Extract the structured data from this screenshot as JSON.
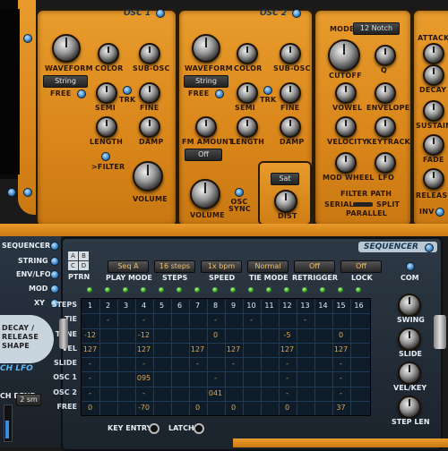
{
  "osc1": {
    "title": "OSC 1",
    "waveform_label": "WAVEFORM",
    "waveform_value": "String",
    "color_label": "COLOR",
    "subosc_label": "SUB-OSC",
    "free_label": "FREE",
    "semi_label": "SEMI",
    "trk_label": "TRK",
    "fine_label": "FINE",
    "length_label": "LENGTH",
    "damp_label": "DAMP",
    "filter_label": ">FILTER",
    "volume_label": "VOLUME"
  },
  "osc2": {
    "title": "OSC 2",
    "waveform_label": "WAVEFORM",
    "waveform_value": "String",
    "color_label": "COLOR",
    "subosc_label": "SUB-OSC",
    "free_label": "FREE",
    "semi_label": "SEMI",
    "trk_label": "TRK",
    "fine_label": "FINE",
    "fm_amount_label": "FM AMOUNT",
    "fm_value": "Off",
    "length_label": "LENGTH",
    "damp_label": "DAMP",
    "volume_label": "VOLUME",
    "osc_sync_label": "OSC SYNC",
    "sat_value": "Sat",
    "dist_label": "DIST"
  },
  "filter": {
    "mode_label": "MODE",
    "mode_value": "12 Notch",
    "cutoff_label": "CUTOFF",
    "q_label": "Q",
    "vowel_label": "VOWEL",
    "envelope_label": "ENVELOPE",
    "velocity_label": "VELOCITY",
    "keytrack_label": "KEYTRACK",
    "modwheel_label": "MOD WHEEL",
    "lfo_label": "LFO",
    "path_label": "FILTER PATH",
    "serial_label": "SERIAL",
    "split_label": "SPLIT",
    "parallel_label": "PARALLEL"
  },
  "env": {
    "attack_label": "ATTACK",
    "decay_label": "DECAY",
    "sustain_label": "SUSTAIN",
    "fade_label": "FADE",
    "release_label": "RELEASE",
    "inv_label": "INV"
  },
  "left": {
    "menu": [
      "SEQUENCER",
      "STRING",
      "ENV/LFO",
      "MOD",
      "XY"
    ],
    "decay_line1": "DECAY /",
    "decay_line2": "RELEASE",
    "decay_line3": "SHAPE",
    "lfo_label": "CH LFO",
    "bend_label": "CH BEND",
    "bend_value": "2 sm"
  },
  "sequencer": {
    "title": "SEQUENCER",
    "ptrn_label": "PTRN",
    "ptrn_buttons": [
      "A",
      "B",
      "C",
      "D"
    ],
    "controls": [
      {
        "value": "Seq A",
        "label": "PLAY MODE"
      },
      {
        "value": "16 steps",
        "label": "STEPS"
      },
      {
        "value": "1x bpm",
        "label": "SPEED"
      },
      {
        "value": "Normal",
        "label": "TIE MODE"
      },
      {
        "value": "Off",
        "label": "RETRIGGER"
      },
      {
        "value": "Off",
        "label": "LOCK"
      }
    ],
    "com_label": "COM",
    "rows": [
      "STEPS",
      "TIE",
      "TUNE",
      "VEL",
      "SLIDE",
      "OSC 1",
      "OSC 2",
      "FREE"
    ],
    "steps": [
      "1",
      "2",
      "3",
      "4",
      "5",
      "6",
      "7",
      "8",
      "9",
      "10",
      "11",
      "12",
      "13",
      "14",
      "15",
      "16"
    ],
    "grid": {
      "TIE": [
        "",
        "-",
        "",
        "-",
        "",
        "",
        "",
        "-",
        "",
        "-",
        "",
        "",
        "-",
        "",
        "",
        ""
      ],
      "TUNE": [
        "-12",
        "",
        "",
        "-12",
        "",
        "",
        "",
        "0",
        "",
        "",
        "",
        "-5",
        "",
        "",
        "0",
        ""
      ],
      "VEL": [
        "127",
        "",
        "",
        "127",
        "",
        "",
        "127",
        "",
        "127",
        "",
        "",
        "127",
        "",
        "",
        "127",
        ""
      ],
      "SLIDE": [
        "-",
        "",
        "",
        "-",
        "",
        "",
        "-",
        "",
        "-",
        "",
        "",
        "-",
        "",
        "",
        "-",
        ""
      ],
      "OSC 1": [
        "-",
        "",
        "",
        "095",
        "",
        "",
        "",
        "-",
        "",
        "",
        "",
        "-",
        "",
        "",
        "-",
        ""
      ],
      "OSC 2": [
        "-",
        "",
        "",
        "-",
        "",
        "",
        "",
        "041",
        "",
        "",
        "",
        "-",
        "",
        "",
        "-",
        ""
      ],
      "FREE": [
        "0",
        "",
        "",
        "-70",
        "",
        "",
        "0",
        "",
        "0",
        "",
        "",
        "0",
        "",
        "",
        "37",
        ""
      ]
    },
    "right_knobs": [
      "SWING",
      "SLIDE",
      "VEL/KEY",
      "STEP LEN"
    ],
    "key_entry_label": "KEY ENTRY",
    "latch_label": "LATCH"
  }
}
